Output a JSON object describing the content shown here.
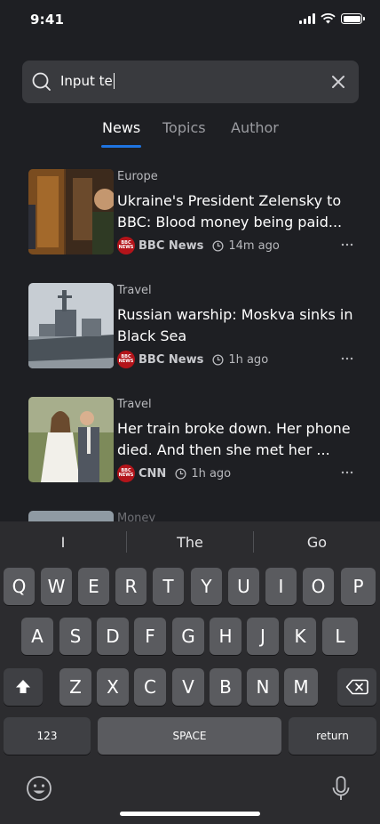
{
  "status": {
    "time": "9:41"
  },
  "search": {
    "query": "Input te"
  },
  "tabs": [
    {
      "label": "News",
      "active": true
    },
    {
      "label": "Topics",
      "active": false
    },
    {
      "label": "Author",
      "active": false
    }
  ],
  "articles": [
    {
      "category": "Europe",
      "headline": "Ukraine's President Zelensky to BBC: Blood money being paid...",
      "source": "BBC News",
      "time": "14m ago"
    },
    {
      "category": "Travel",
      "headline": "Russian warship: Moskva sinks in Black Sea",
      "source": "BBC News",
      "time": "1h ago"
    },
    {
      "category": "Travel",
      "headline": "Her train broke down. Her phone died. And then she met her ...",
      "source": "CNN",
      "time": "1h ago"
    },
    {
      "category": "Money"
    }
  ],
  "keyboard": {
    "suggestions": [
      "I",
      "The",
      "Go"
    ],
    "row1": [
      "Q",
      "W",
      "E",
      "R",
      "T",
      "Y",
      "U",
      "I",
      "O",
      "P"
    ],
    "row2": [
      "A",
      "S",
      "D",
      "F",
      "G",
      "H",
      "J",
      "K",
      "L"
    ],
    "row3": [
      "Z",
      "X",
      "C",
      "V",
      "B",
      "N",
      "M"
    ],
    "numbers_label": "123",
    "space_label": "SPACE",
    "return_label": "return"
  }
}
